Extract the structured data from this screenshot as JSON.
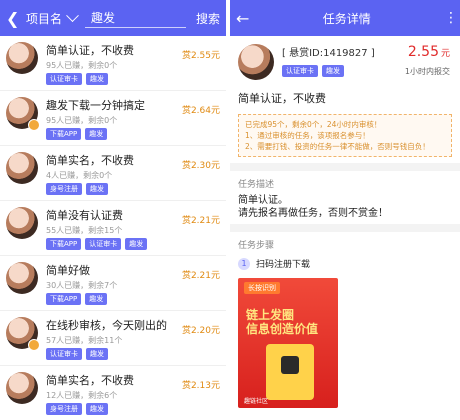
{
  "left": {
    "back_icon": "back-arrow-icon",
    "filter_label": "项目名",
    "search_value": "趣发",
    "search_button": "搜索",
    "items": [
      {
        "title": "简单认证，不收费",
        "stats": "95人已赚，剩余0个",
        "tags": [
          "认证审卡",
          "趣发"
        ],
        "reward": "赏2.55元"
      },
      {
        "title": "趣发下载一分钟搞定",
        "stats": "95人已赚，剩余0个",
        "tags": [
          "下载APP",
          "趣发"
        ],
        "reward": "赏2.64元"
      },
      {
        "title": "简单实名，不收费",
        "stats": "4人已赚，剩余0个",
        "tags": [
          "身号注册",
          "趣发"
        ],
        "reward": "赏2.30元"
      },
      {
        "title": "简单没有认证费",
        "stats": "55人已赚，剩余15个",
        "tags": [
          "下载APP",
          "认证审卡",
          "趣发"
        ],
        "reward": "赏2.21元"
      },
      {
        "title": "简单好做",
        "stats": "30人已赚，剩余7个",
        "tags": [
          "下载APP",
          "趣发"
        ],
        "reward": "赏2.21元"
      },
      {
        "title": "在线秒审核，今天刚出的",
        "stats": "57人已赚，剩余11个",
        "tags": [
          "认证审卡",
          "趣发"
        ],
        "reward": "赏2.20元"
      },
      {
        "title": "简单实名，不收费",
        "stats": "12人已赚，剩余6个",
        "tags": [
          "身号注册",
          "趣发"
        ],
        "reward": "赏2.13元"
      }
    ]
  },
  "right": {
    "back_icon": "back-arrow-icon",
    "title": "任务详情",
    "more_icon": "more-vertical-icon",
    "reward_id": "[ 悬赏ID:1419827 ]",
    "price_value": "2.55",
    "price_unit": "元",
    "time_note": "1小时内报交",
    "tags": [
      "认证审卡",
      "趣发"
    ],
    "task_title": "简单认证，不收费",
    "notice_lines": [
      "已完成95个，剩余0个，24小时内审核！",
      "1、通过审核的任务，该项报名参与！",
      "2、需要打钱、投资的任务一律不能做，否则号钱自负！"
    ],
    "section_desc_label": "任务描述",
    "desc_lines": [
      "简单认证。",
      "请先报名再做任务，否则不赏金！"
    ],
    "section_steps_label": "任务步骤",
    "step_num": "1",
    "step_title": "扫码注册下载",
    "promo": {
      "sign_label": "长按识别",
      "headline_1": "链上发圈",
      "headline_2": "信息创造价值",
      "bottom_text": "趣链社区"
    }
  },
  "colors": {
    "primary": "#5b63f2",
    "reward": "#e08a12",
    "price": "#e02b2b",
    "notice": "#d9902d"
  }
}
